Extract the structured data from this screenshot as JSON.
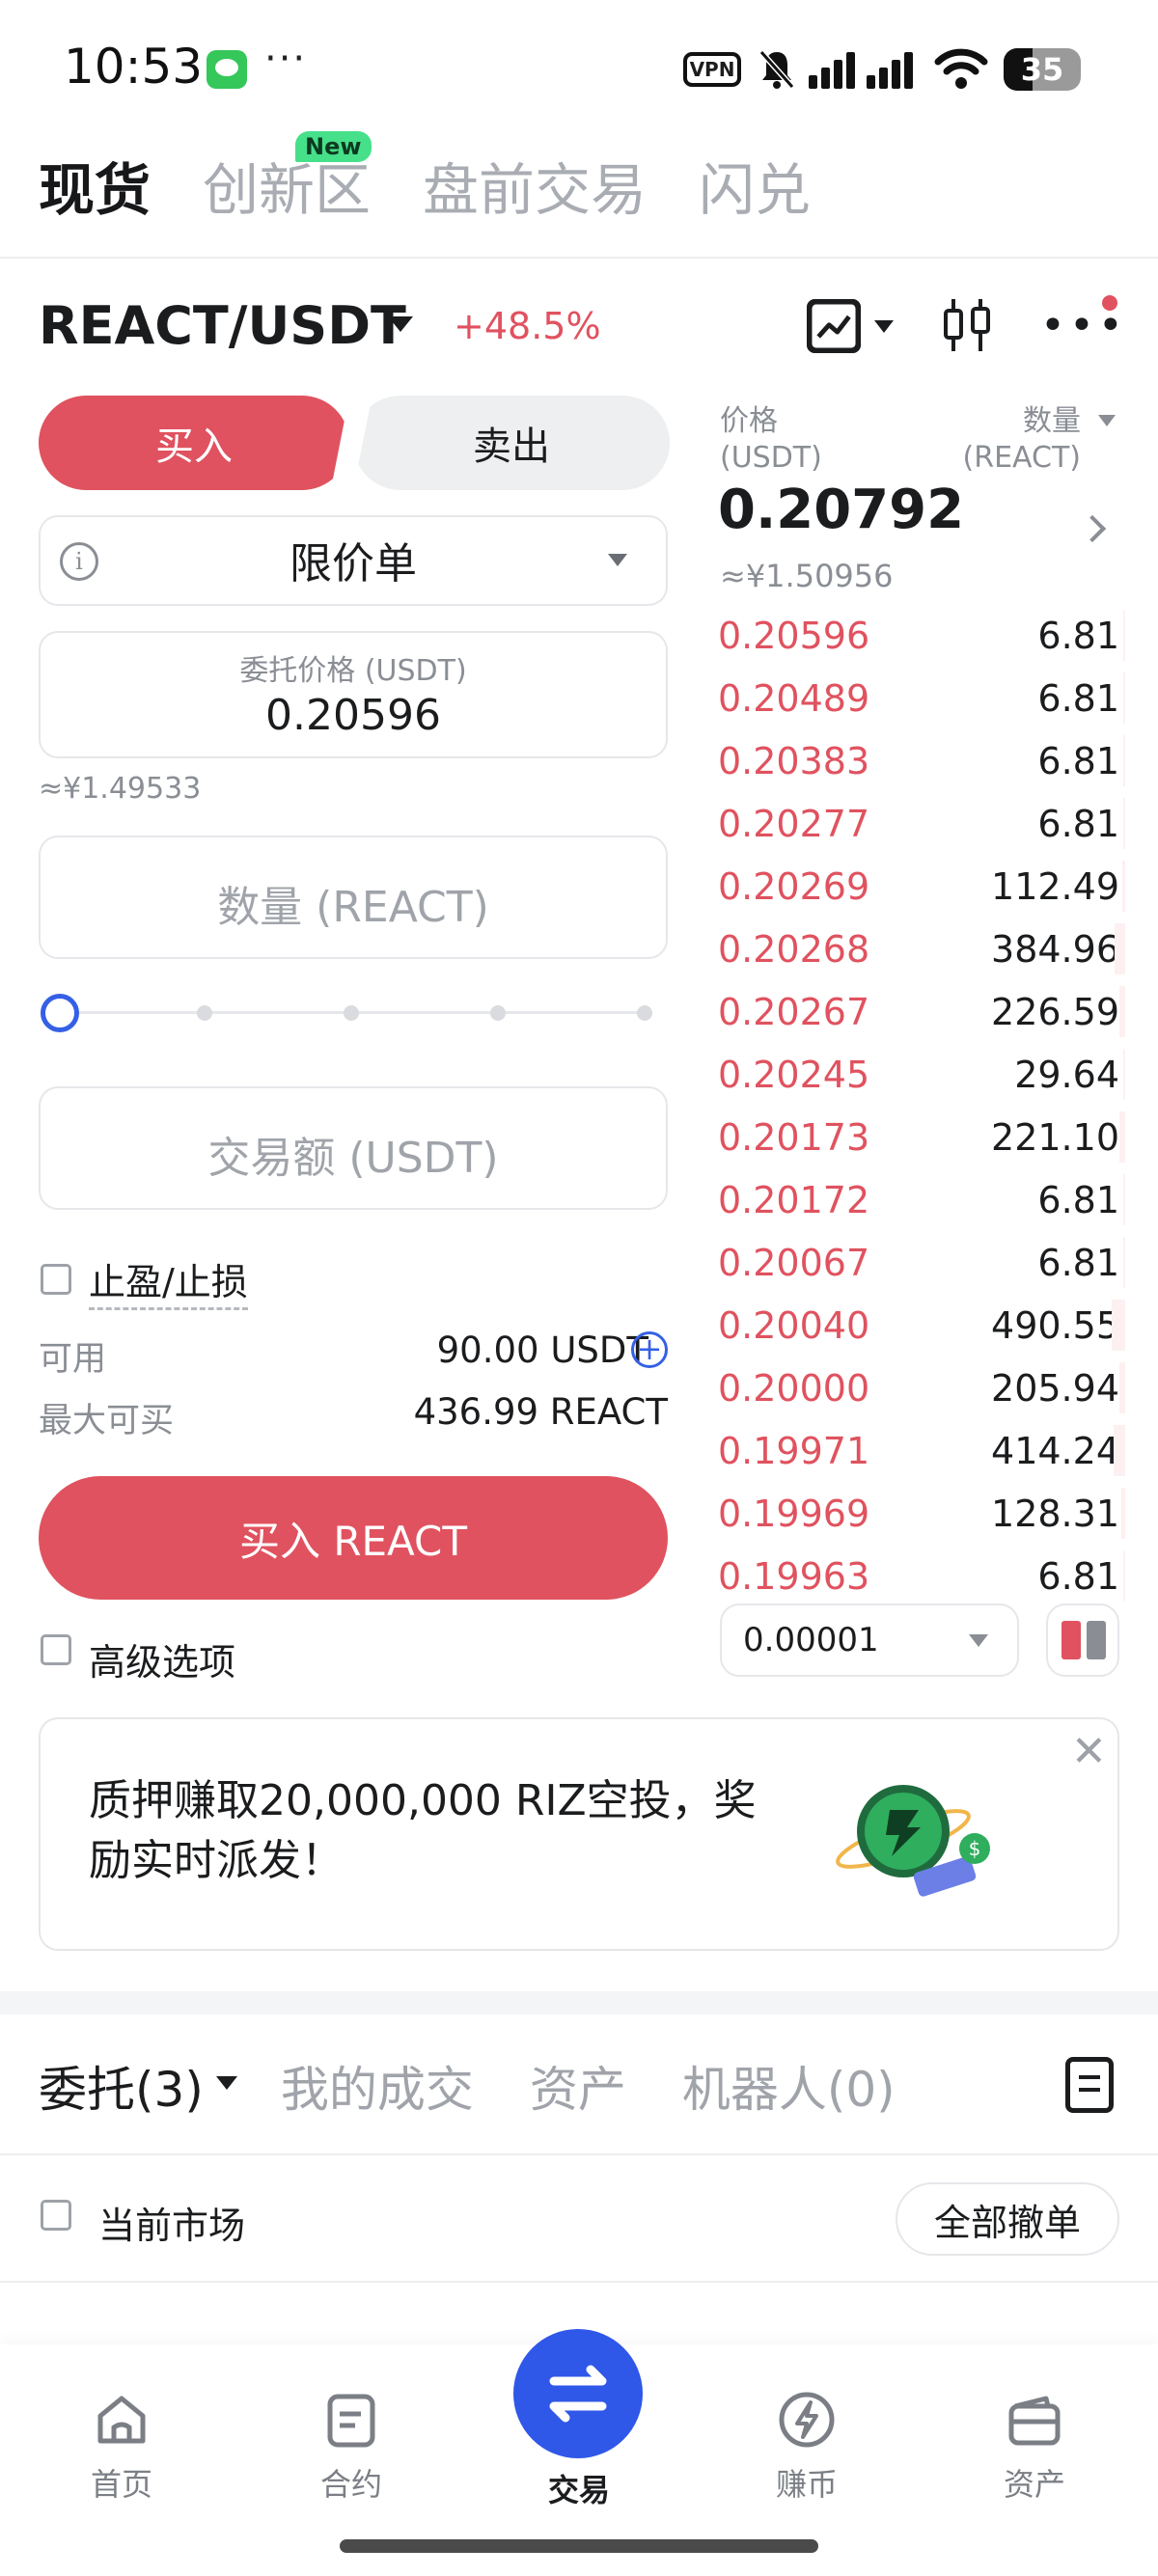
{
  "status_bar": {
    "time": "10:53",
    "more": "···",
    "vpn": "VPN",
    "battery": "35"
  },
  "top_tabs": [
    {
      "label": "现货",
      "active": true
    },
    {
      "label": "创新区",
      "active": false
    },
    {
      "label": "盘前交易",
      "active": false
    },
    {
      "label": "闪兑",
      "active": false
    }
  ],
  "new_badge": "New",
  "pair": {
    "name": "REACT/USDT",
    "change": "+48.5%"
  },
  "trade_form": {
    "buy_tab": "买入",
    "sell_tab": "卖出",
    "order_type": "限价单",
    "price_label": "委托价格 (USDT)",
    "price_value": "0.20596",
    "price_cny": "≈¥1.49533",
    "qty_placeholder": "数量 (REACT)",
    "slider_percent": 0,
    "amount_placeholder": "交易额 (USDT)",
    "tpsl_label": "止盈/止损",
    "available_label": "可用",
    "available_value": "90.00 USDT",
    "max_buy_label": "最大可买",
    "max_buy_value": "436.99 REACT",
    "buy_button": "买入 REACT",
    "advanced_label": "高级选项"
  },
  "order_book": {
    "price_head": "价格",
    "price_unit": "(USDT)",
    "qty_head": "数量",
    "qty_unit": "(REACT)",
    "last_price": "0.20792",
    "last_cny": "≈¥1.50956",
    "rows": [
      {
        "price": "0.20596",
        "qty": "6.81"
      },
      {
        "price": "0.20489",
        "qty": "6.81"
      },
      {
        "price": "0.20383",
        "qty": "6.81"
      },
      {
        "price": "0.20277",
        "qty": "6.81"
      },
      {
        "price": "0.20269",
        "qty": "112.49"
      },
      {
        "price": "0.20268",
        "qty": "384.96"
      },
      {
        "price": "0.20267",
        "qty": "226.59"
      },
      {
        "price": "0.20245",
        "qty": "29.64"
      },
      {
        "price": "0.20173",
        "qty": "221.10"
      },
      {
        "price": "0.20172",
        "qty": "6.81"
      },
      {
        "price": "0.20067",
        "qty": "6.81"
      },
      {
        "price": "0.20040",
        "qty": "490.55"
      },
      {
        "price": "0.20000",
        "qty": "205.94"
      },
      {
        "price": "0.19971",
        "qty": "414.24"
      },
      {
        "price": "0.19969",
        "qty": "128.31"
      },
      {
        "price": "0.19963",
        "qty": "6.81"
      }
    ],
    "tick_size": "0.00001"
  },
  "banner": {
    "text": "质押赚取20,000,000 RIZ空投，奖励实时派发！",
    "close": "✕"
  },
  "bottom_tabs": [
    {
      "label": "委托(3)",
      "active": true
    },
    {
      "label": "我的成交",
      "active": false
    },
    {
      "label": "资产",
      "active": false
    },
    {
      "label": "机器人(0)",
      "active": false
    }
  ],
  "orders": {
    "current_market_label": "当前市场",
    "cancel_all": "全部撤单"
  },
  "nav": [
    {
      "label": "首页",
      "icon": "home-icon"
    },
    {
      "label": "合约",
      "icon": "contract-icon"
    },
    {
      "label": "交易",
      "icon": "trade-icon"
    },
    {
      "label": "赚币",
      "icon": "earn-icon"
    },
    {
      "label": "资产",
      "icon": "wallet-icon"
    }
  ],
  "colors": {
    "buy": "#e0525f",
    "accent_blue": "#2f57e8",
    "muted": "#8a8e94"
  }
}
